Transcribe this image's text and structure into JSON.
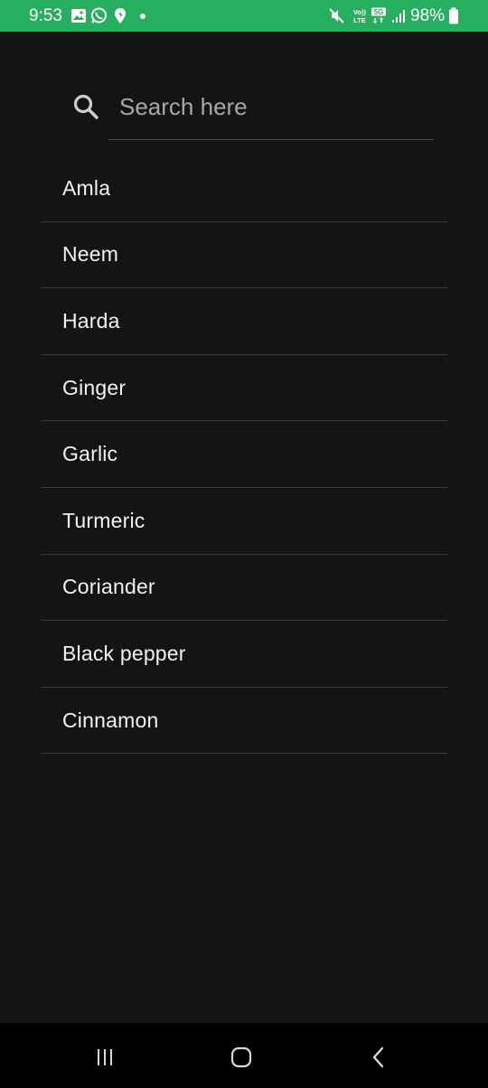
{
  "status_bar": {
    "time": "9:53",
    "battery_percent": "98%",
    "network": "5G",
    "volte_label": "VoLTE",
    "background_color": "#27ae60",
    "icons": [
      "gallery-icon",
      "whatsapp-icon",
      "location-pin-icon",
      "dot-icon",
      "mute-icon",
      "volte-icon",
      "5g-icon",
      "signal-icon",
      "battery-icon"
    ]
  },
  "search": {
    "placeholder": "Search here",
    "value": "",
    "icon": "search-icon"
  },
  "list": {
    "items": [
      {
        "label": "Amla"
      },
      {
        "label": "Neem"
      },
      {
        "label": "Harda"
      },
      {
        "label": "Ginger"
      },
      {
        "label": "Garlic"
      },
      {
        "label": "Turmeric"
      },
      {
        "label": "Coriander"
      },
      {
        "label": "Black pepper"
      },
      {
        "label": "Cinnamon"
      }
    ]
  },
  "nav_bar": {
    "buttons": [
      "recents-icon",
      "home-icon",
      "back-icon"
    ]
  },
  "colors": {
    "background": "#141414",
    "accent": "#27ae60",
    "text": "#f2f2f2",
    "divider": "#3a3a3a"
  }
}
